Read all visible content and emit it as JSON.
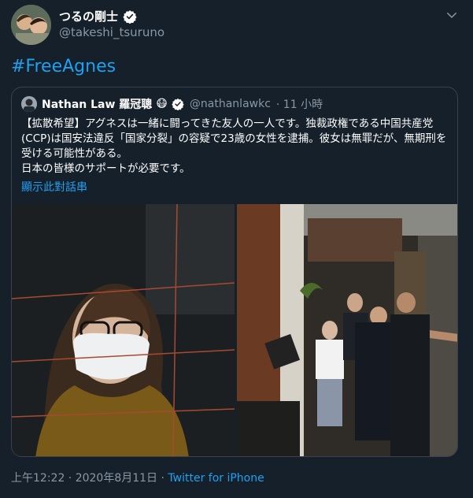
{
  "author": {
    "name": "つるの剛士",
    "handle": "@takeshi_tsuruno"
  },
  "tweet": {
    "text": "#FreeAgnes"
  },
  "quoted": {
    "name": "Nathan Law 羅冠聰",
    "emoji": "😷",
    "handle": "@nathanlawkc",
    "time": "· 11 小時",
    "text": "【拡散希望】アグネスは一緒に闘ってきた友人の一人です。独裁政権である中国共産党(CCP)は国安法違反「国家分裂」の容疑で23歳の女性を逮捕。彼女は無罪だが、無期刑を受ける可能性がある。\n日本の皆様のサポートが必要です。",
    "show_thread": "顯示此對話串"
  },
  "footer": {
    "timestamp": "上午12:22 · 2020年8月11日 · ",
    "source": "Twitter for iPhone"
  },
  "colors": {
    "background": "#15202b",
    "accent": "#1da1f2",
    "secondary_text": "#8899a6",
    "border": "#38444d"
  },
  "icons": {
    "verified": "verified-badge-icon",
    "caret": "chevron-down-icon"
  }
}
